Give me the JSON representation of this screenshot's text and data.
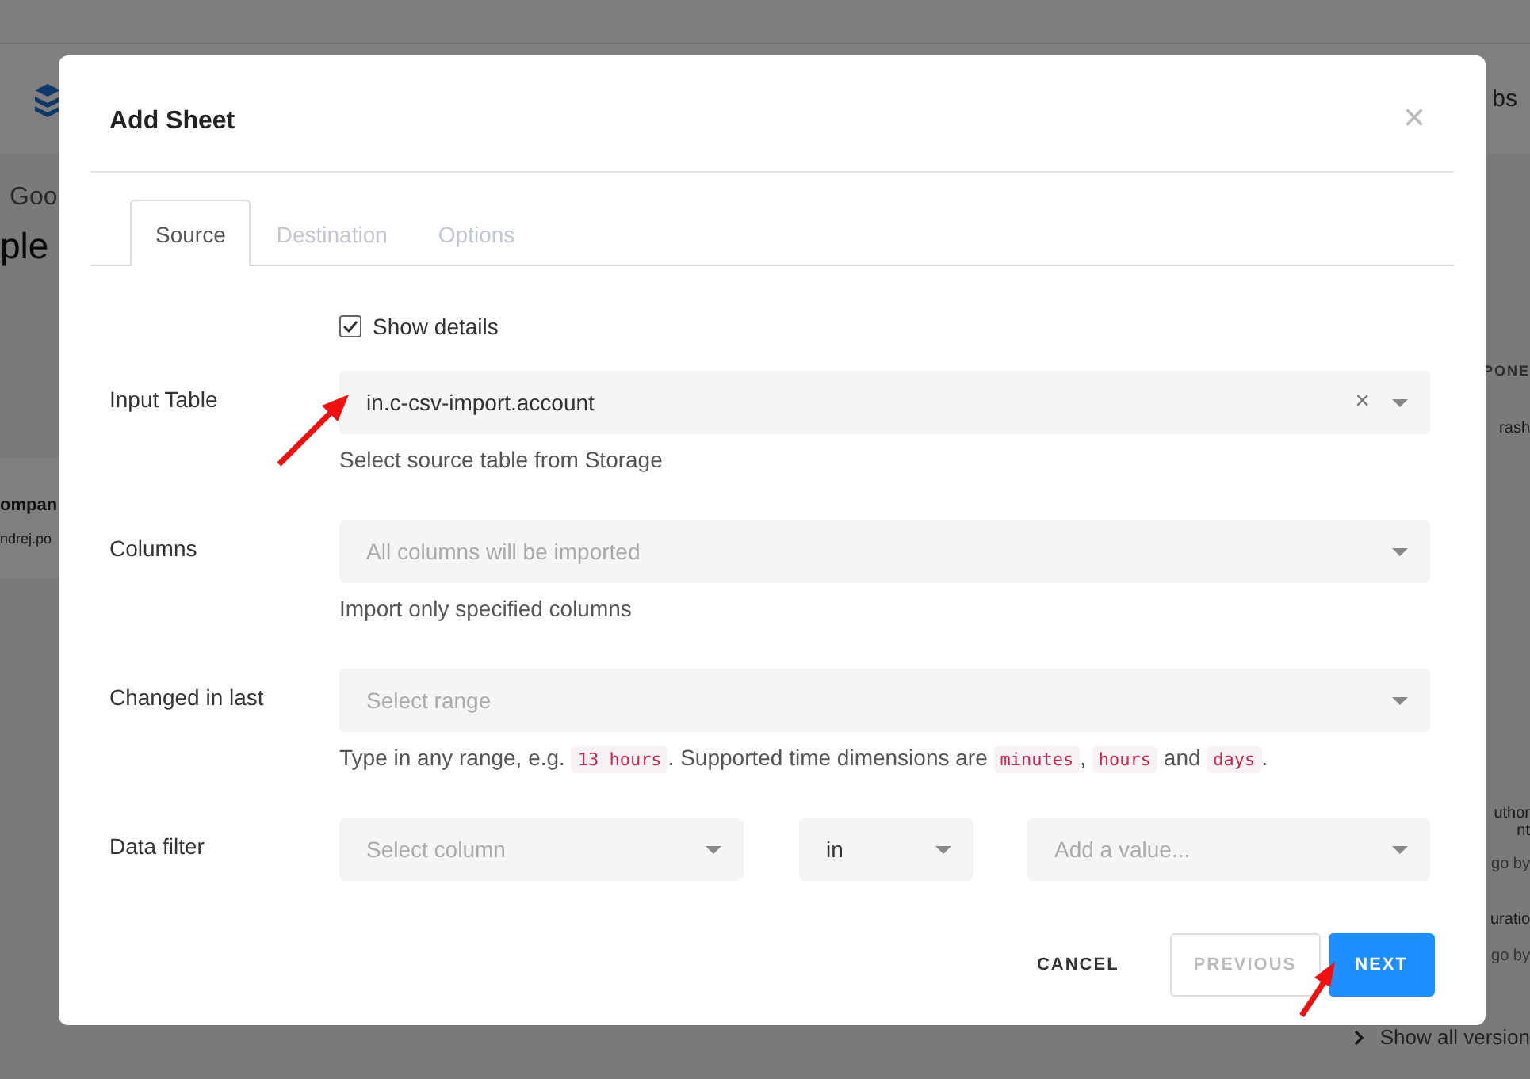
{
  "background": {
    "header_text": "bs",
    "breadcrumb": "Goo",
    "page_title": "ple",
    "left_texts": [
      {
        "text": "ompan",
        "kind": "bold"
      },
      {
        "text": "ndrej.po",
        "kind": "small"
      }
    ],
    "right_texts": [
      {
        "text": "PONE",
        "kind": "caps"
      },
      {
        "text": "rash",
        "kind": "plain"
      },
      {
        "text": "uthor",
        "kind": "plain"
      },
      {
        "text": "nt",
        "kind": "plain"
      },
      {
        "text": "go by",
        "kind": "muted"
      },
      {
        "text": "uratio",
        "kind": "plain"
      },
      {
        "text": "go by",
        "kind": "muted"
      }
    ],
    "show_all": "Show all version"
  },
  "modal": {
    "title": "Add Sheet",
    "close": "×",
    "tabs": [
      {
        "label": "Source",
        "selected": true
      },
      {
        "label": "Destination",
        "selected": false
      },
      {
        "label": "Options",
        "selected": false
      }
    ],
    "show_details": {
      "label": "Show details",
      "checked": true
    },
    "fields": [
      {
        "label": "Input Table",
        "kind": "select",
        "value": "in.c-csv-import.account",
        "clear": "×",
        "help": [
          {
            "kind": "text",
            "text": "Select source table from Storage"
          }
        ]
      },
      {
        "label": "Columns",
        "kind": "select",
        "placeholder": "All columns will be imported",
        "help": [
          {
            "kind": "text",
            "text": "Import only specified columns"
          }
        ]
      },
      {
        "label": "Changed in last",
        "kind": "select",
        "placeholder": "Select range",
        "help": [
          {
            "kind": "text",
            "text": "Type in any range, e.g. "
          },
          {
            "kind": "code",
            "text": "13 hours"
          },
          {
            "kind": "text",
            "text": ". Supported time dimensions are "
          },
          {
            "kind": "code",
            "text": "minutes"
          },
          {
            "kind": "text",
            "text": ", "
          },
          {
            "kind": "code",
            "text": "hours"
          },
          {
            "kind": "text",
            "text": " and "
          },
          {
            "kind": "code",
            "text": "days"
          },
          {
            "kind": "text",
            "text": "."
          }
        ]
      },
      {
        "label": "Data filter",
        "kind": "filter",
        "parts": [
          {
            "placeholder": "Select column"
          },
          {
            "value": "in"
          },
          {
            "placeholder": "Add a value..."
          }
        ]
      }
    ],
    "buttons": [
      {
        "label": "CANCEL",
        "kind": "link",
        "disabled": false
      },
      {
        "label": "PREVIOUS",
        "kind": "outline",
        "disabled": true
      },
      {
        "label": "NEXT",
        "kind": "primary",
        "disabled": false
      }
    ]
  }
}
